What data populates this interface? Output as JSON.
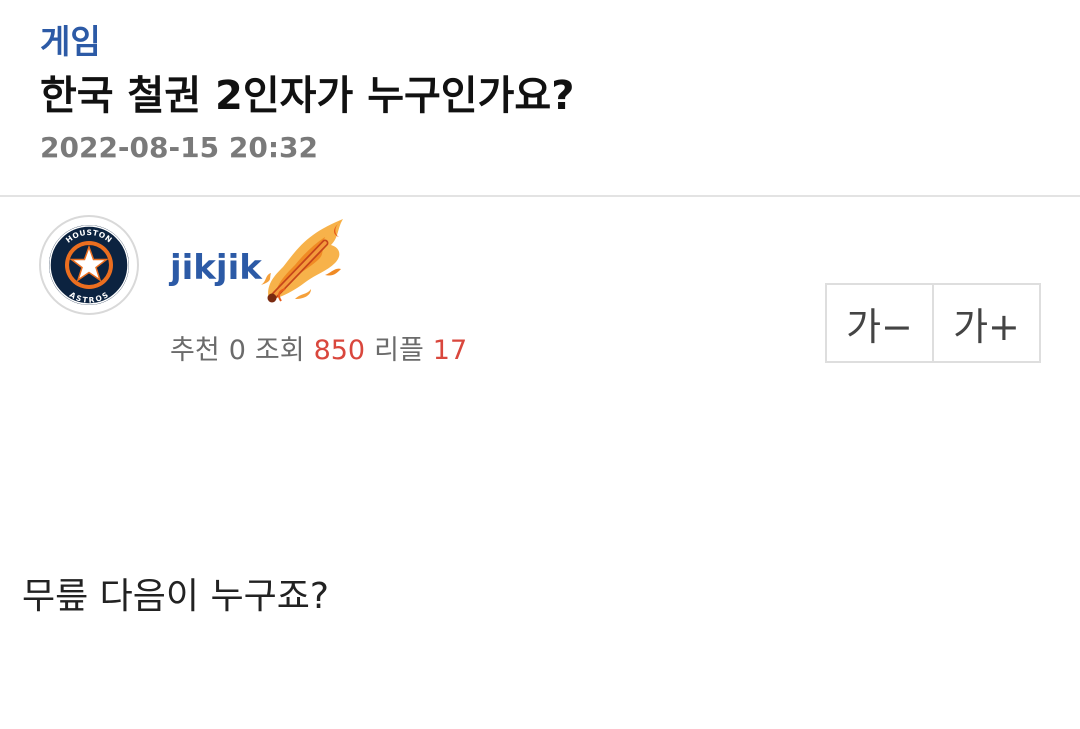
{
  "post": {
    "category": "게임",
    "title": "한국 철권 2인자가 누구인가요?",
    "timestamp": "2022-08-15 20:32",
    "body": "무릎 다음이 누구죠?"
  },
  "author": {
    "username": "jikjik",
    "avatar_icon": "houston-astros-logo-icon",
    "avatar_text": {
      "top": "HOUSTON",
      "bottom": "ASTROS"
    },
    "badge_icon": "flaming-bat-icon"
  },
  "stats": {
    "recommend_label": "추천",
    "recommend_value": "0",
    "views_label": "조회",
    "views_value": "850",
    "replies_label": "리플",
    "replies_value": "17"
  },
  "font_controls": {
    "decrease_label": "가−",
    "increase_label": "가+"
  },
  "colors": {
    "accent_blue": "#2c5aa6",
    "highlight_red": "#d9473d",
    "meta_gray": "#7a7a7a",
    "astros_navy": "#0c2340",
    "astros_orange": "#eb6e1f"
  }
}
